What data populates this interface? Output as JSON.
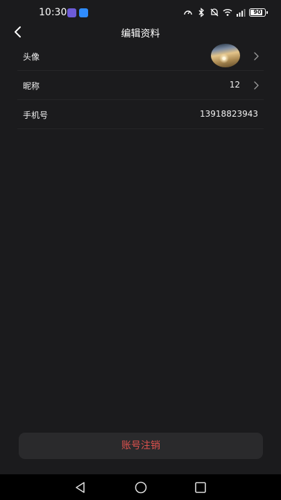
{
  "status_bar": {
    "time": "10:30",
    "battery_level": "90",
    "icons": [
      "app-badge-purple",
      "app-badge-cloud",
      "speed-icon",
      "bluetooth-icon",
      "mute-icon",
      "wifi-icon",
      "signal-icon",
      "battery-icon"
    ]
  },
  "header": {
    "title": "编辑资料"
  },
  "profile": {
    "avatar_label": "头像",
    "nickname_label": "昵称",
    "nickname_value": "12",
    "phone_label": "手机号",
    "phone_value": "13918823943"
  },
  "actions": {
    "deactivate_label": "账号注销"
  },
  "colors": {
    "background": "#1b1b1d",
    "danger": "#e0524e",
    "button_bg": "#2a2a2c"
  }
}
